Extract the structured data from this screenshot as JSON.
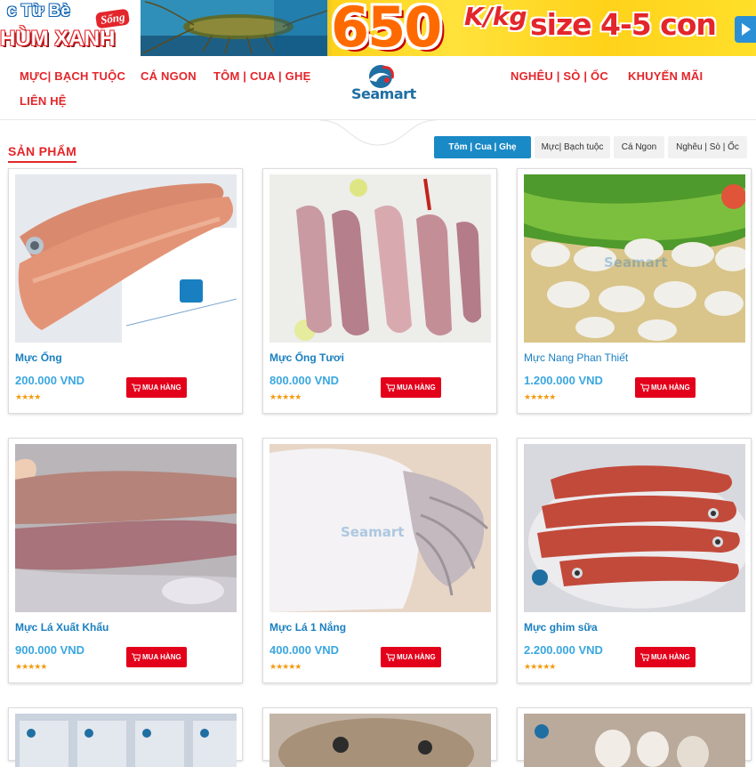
{
  "banner": {
    "line1": "c Từ Bè",
    "badge": "Sống",
    "line2": "HÙM XANH",
    "price": "650",
    "unit": "K/kg",
    "size": "size 4-5 con"
  },
  "nav": {
    "items_left": [
      "MỰC| BẠCH TUỘC",
      "CÁ NGON",
      "TÔM | CUA | GHẸ",
      "LIÊN HỆ"
    ],
    "items_right": [
      "NGHÊU | SÒ | ỐC",
      "KHUYẾN MÃI"
    ],
    "logo_text": "Seamart"
  },
  "section": {
    "title": "SẢN PHẨM",
    "tabs": [
      "Tôm | Cua | Ghẹ",
      "Mực| Bạch tuộc",
      "Cá Ngon",
      "Nghêu | Sò | Ốc"
    ],
    "active_tab": "Tôm | Cua | Ghẹ"
  },
  "products": [
    {
      "name": "Mực Ống",
      "price": "200.000 VND",
      "rating": 4,
      "buy_label": "MUA HÀNG"
    },
    {
      "name": "Mực Ống Tươi",
      "price": "800.000 VND",
      "rating": 5,
      "buy_label": "MUA HÀNG"
    },
    {
      "name": "Mực Nang Phan Thiết",
      "price": "1.200.000 VND",
      "rating": 5,
      "buy_label": "MUA HÀNG"
    },
    {
      "name": "Mực Lá Xuất Khẩu",
      "price": "900.000 VND",
      "rating": 5,
      "buy_label": "MUA HÀNG"
    },
    {
      "name": "Mực Lá 1 Nắng",
      "price": "400.000 VND",
      "rating": 5,
      "buy_label": "MUA HÀNG"
    },
    {
      "name": "Mực ghim sữa",
      "price": "2.200.000 VND",
      "rating": 5,
      "buy_label": "MUA HÀNG"
    }
  ],
  "watermark": "Seamart",
  "colors": {
    "accent_red": "#e3262b",
    "accent_blue": "#1a8ac6",
    "star": "#f39c12"
  }
}
